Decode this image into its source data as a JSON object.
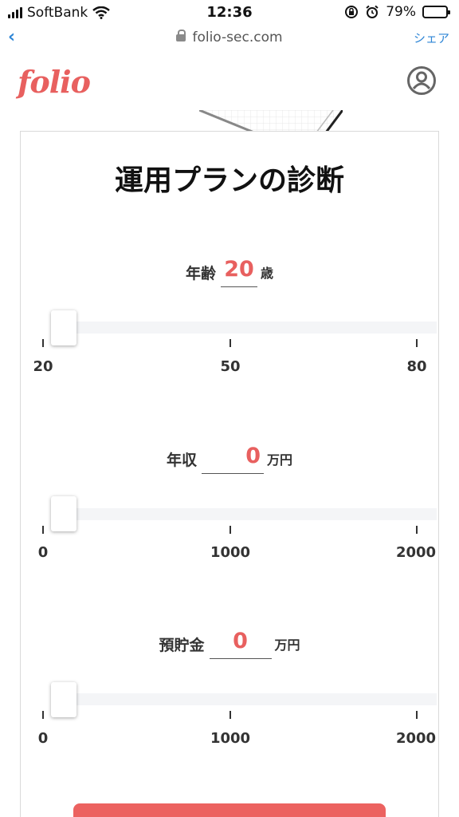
{
  "status_bar": {
    "carrier": "SoftBank",
    "time": "12:36",
    "battery_percent": "79%",
    "battery_level": 0.79
  },
  "browser": {
    "url": "folio-sec.com",
    "share_label": "シェア"
  },
  "site": {
    "logo_text": "folio",
    "brand_color": "#e8605f"
  },
  "card": {
    "title": "運用プランの診断",
    "fields": [
      {
        "label": "年齢",
        "value": "20",
        "unit": "歳",
        "ticks": [
          "20",
          "50",
          "80"
        ]
      },
      {
        "label": "年収",
        "value": "0",
        "unit": "万円",
        "ticks": [
          "0",
          "1000",
          "2000"
        ]
      },
      {
        "label": "預貯金",
        "value": "0",
        "unit": "万円",
        "ticks": [
          "0",
          "1000",
          "2000"
        ]
      }
    ]
  }
}
